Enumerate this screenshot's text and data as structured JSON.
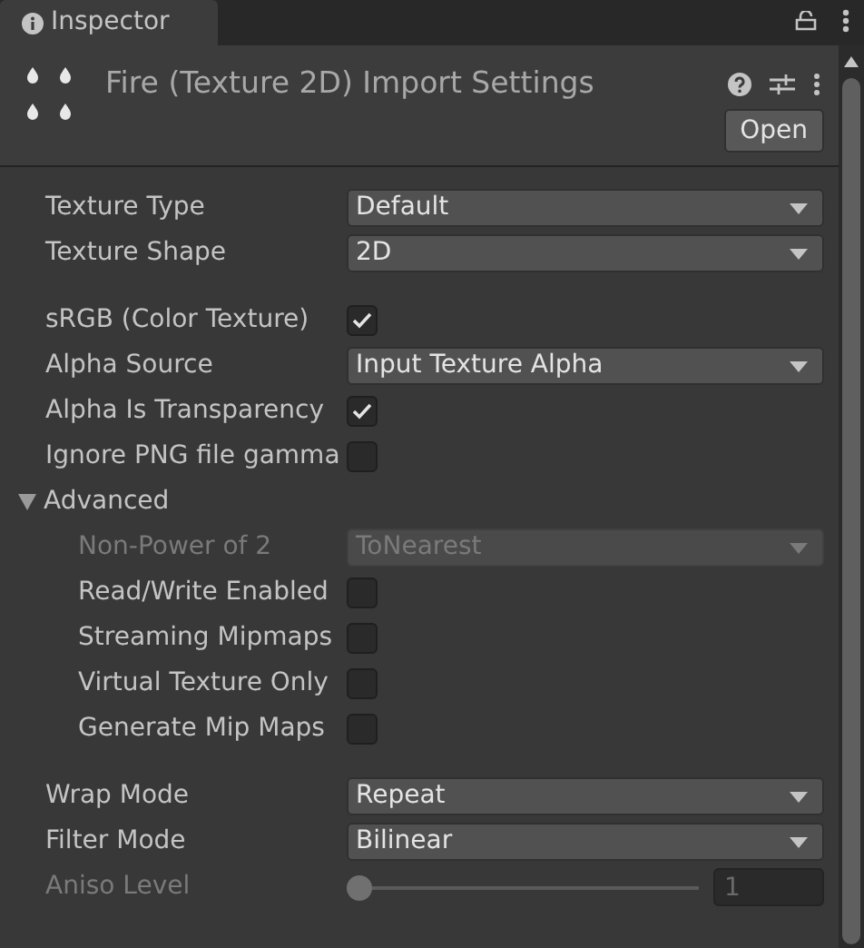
{
  "tab": {
    "label": "Inspector",
    "selected": true
  },
  "header": {
    "title": "Fire (Texture 2D) Import Settings",
    "open_button": "Open"
  },
  "sections": [
    {
      "rows": [
        {
          "kind": "dropdown",
          "label": "Texture Type",
          "value": "Default",
          "disabled": false
        },
        {
          "kind": "dropdown",
          "label": "Texture Shape",
          "value": "2D",
          "disabled": false
        }
      ]
    },
    {
      "rows": [
        {
          "kind": "checkbox",
          "label": "sRGB (Color Texture)",
          "checked": true,
          "disabled": false
        },
        {
          "kind": "dropdown",
          "label": "Alpha Source",
          "value": "Input Texture Alpha",
          "disabled": false
        },
        {
          "kind": "checkbox",
          "label": "Alpha Is Transparency",
          "checked": true,
          "disabled": false
        },
        {
          "kind": "checkbox",
          "label": "Ignore PNG file gamma",
          "checked": false,
          "disabled": false
        },
        {
          "kind": "foldout",
          "label": "Advanced",
          "expanded": true,
          "children": [
            {
              "kind": "dropdown",
              "label": "Non-Power of 2",
              "value": "ToNearest",
              "disabled": true
            },
            {
              "kind": "checkbox",
              "label": "Read/Write Enabled",
              "checked": false,
              "disabled": false
            },
            {
              "kind": "checkbox",
              "label": "Streaming Mipmaps",
              "checked": false,
              "disabled": false
            },
            {
              "kind": "checkbox",
              "label": "Virtual Texture Only",
              "checked": false,
              "disabled": false
            },
            {
              "kind": "checkbox",
              "label": "Generate Mip Maps",
              "checked": false,
              "disabled": false
            }
          ]
        }
      ]
    },
    {
      "rows": [
        {
          "kind": "dropdown",
          "label": "Wrap Mode",
          "value": "Repeat",
          "disabled": false
        },
        {
          "kind": "dropdown",
          "label": "Filter Mode",
          "value": "Bilinear",
          "disabled": false
        },
        {
          "kind": "slider",
          "label": "Aniso Level",
          "level": 0,
          "value": "1",
          "disabled": true
        }
      ]
    }
  ]
}
